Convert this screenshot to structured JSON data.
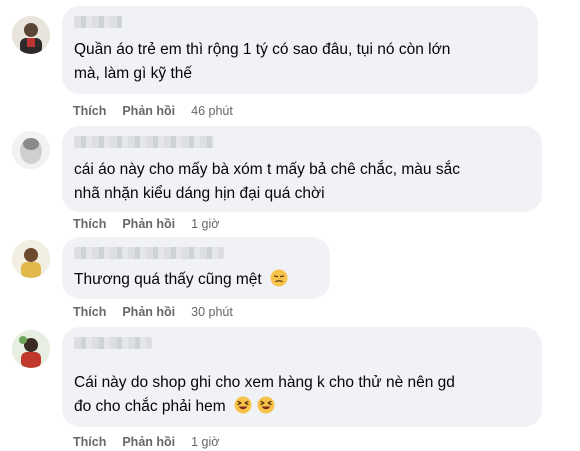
{
  "comments": [
    {
      "text_lines": [
        "Quần áo trẻ em thì rộng 1 tý có sao đâu, tụi nó còn lớn",
        "mà, làm gì kỹ thế"
      ],
      "like_label": "Thích",
      "reply_label": "Phản hồi",
      "time": "46 phút"
    },
    {
      "text_lines": [
        "cái áo này cho mấy bà xóm t mấy bả chê chắc, màu sắc",
        "nhã nhặn kiểu dáng hịn đại quá chời"
      ],
      "like_label": "Thích",
      "reply_label": "Phản hồi",
      "time": "1 giờ"
    },
    {
      "text_lines": [
        "Thương quá thấy cũng mệt"
      ],
      "emojis": [
        "tired-face-emoji"
      ],
      "like_label": "Thích",
      "reply_label": "Phản hồi",
      "time": "30 phút"
    },
    {
      "text_lines": [
        "Cái này do shop ghi cho xem hàng k cho thử nè nên gd",
        "đo cho chắc phải hem"
      ],
      "emojis": [
        "squinting-laugh-emoji",
        "squinting-laugh-emoji"
      ],
      "like_label": "Thích",
      "reply_label": "Phản hồi",
      "time": "1 giờ"
    }
  ],
  "colors": {
    "bubble": "#f0f2f5",
    "text": "#050505",
    "meta": "#65676b",
    "emoji": "#f7c34a"
  }
}
